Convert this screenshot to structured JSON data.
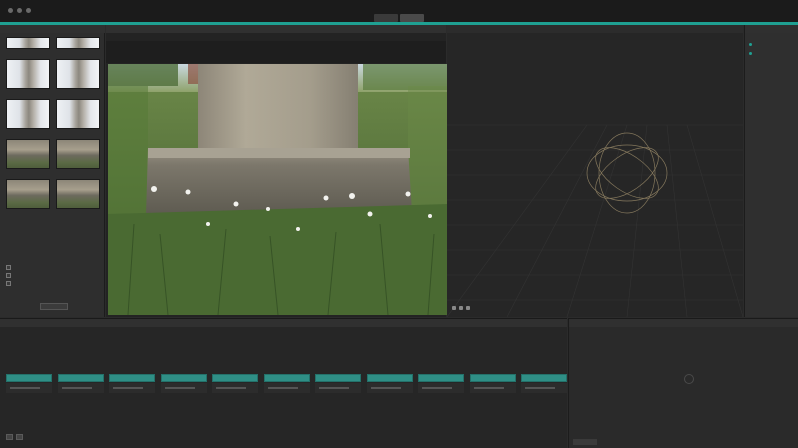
{
  "workspace_tabs": [
    "",
    ""
  ],
  "panels": {
    "images": "",
    "image_viewer": "",
    "viewer_3d": "",
    "graph_editor": "",
    "node_attributes": "",
    "right": ""
  },
  "images": {
    "thumbnails": [
      {
        "kind": "col",
        "label": ""
      },
      {
        "kind": "col",
        "label": ""
      },
      {
        "kind": "col",
        "label": ""
      },
      {
        "kind": "col",
        "label": ""
      },
      {
        "kind": "col",
        "label": ""
      },
      {
        "kind": "col",
        "label": ""
      },
      {
        "kind": "base",
        "label": ""
      },
      {
        "kind": "base",
        "label": ""
      },
      {
        "kind": "base",
        "label": ""
      },
      {
        "kind": "base",
        "label": ""
      }
    ],
    "options": [
      "",
      "",
      ""
    ],
    "button": ""
  },
  "graph_nodes": [
    {
      "label": ""
    },
    {
      "label": ""
    },
    {
      "label": ""
    },
    {
      "label": ""
    },
    {
      "label": ""
    },
    {
      "label": ""
    },
    {
      "label": ""
    },
    {
      "label": ""
    },
    {
      "label": ""
    },
    {
      "label": ""
    },
    {
      "label": ""
    }
  ],
  "colors": {
    "accent": "#1fa092",
    "node": "#2f8f86",
    "background": "#2b2b2b"
  }
}
